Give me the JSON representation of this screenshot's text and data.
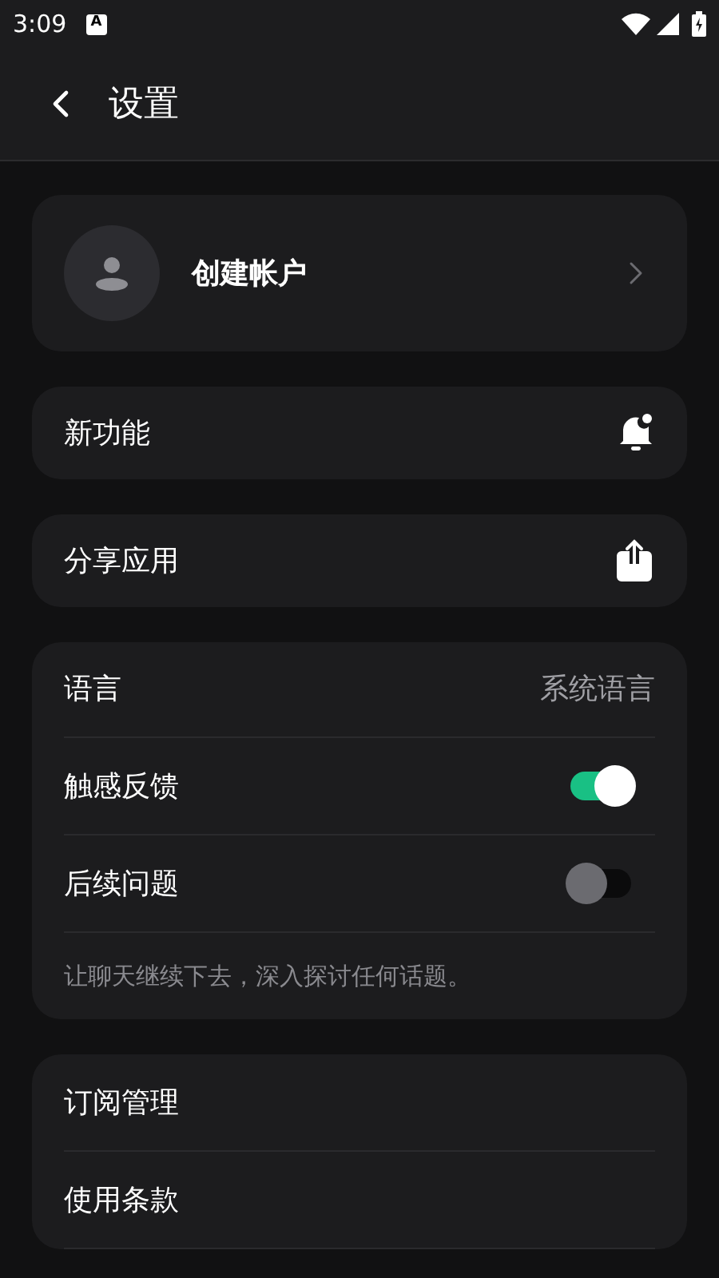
{
  "status_bar": {
    "time": "3:09",
    "badge": "A"
  },
  "header": {
    "title": "设置"
  },
  "sections": [
    {
      "rows": [
        {
          "kind": "account",
          "label": "创建帐户"
        }
      ]
    },
    {
      "rows": [
        {
          "kind": "bell",
          "label": "新功能"
        }
      ]
    },
    {
      "rows": [
        {
          "kind": "share",
          "label": "分享应用"
        }
      ]
    },
    {
      "rows": [
        {
          "kind": "value",
          "label": "语言",
          "value": "系统语言"
        },
        {
          "kind": "toggle",
          "label": "触感反馈",
          "on": true
        },
        {
          "kind": "toggle",
          "label": "后续问题",
          "on": false
        },
        {
          "kind": "note",
          "label": "让聊天继续下去，深入探讨任何话题。"
        }
      ]
    },
    {
      "rows": [
        {
          "kind": "plain",
          "label": "订阅管理"
        },
        {
          "kind": "plain",
          "label": "使用条款"
        }
      ]
    }
  ]
}
